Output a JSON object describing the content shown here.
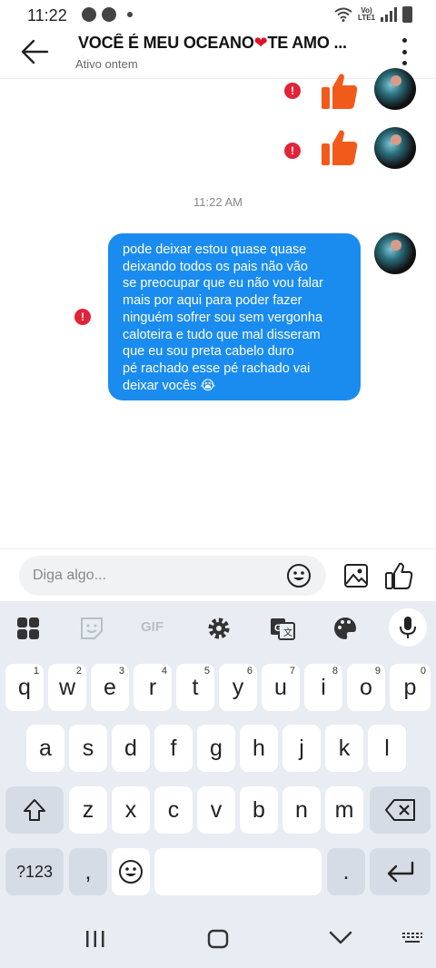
{
  "status": {
    "time": "11:22",
    "network": "Vo)\nLTE1"
  },
  "header": {
    "title_part1": "VOCÊ É MEU OCEANO",
    "title_heart": "❤",
    "title_part2": "TE AMO ...",
    "subtitle": "Ativo ontem"
  },
  "messages": {
    "error_mark": "!",
    "timestamp": "11:22 AM",
    "bubble_lines": [
      "pode deixar estou quase quase",
      "deixando todos os pais não vão",
      "se preocupar que eu não vou falar",
      "mais por aqui para poder fazer",
      "ninguém sofrer sou sem vergonha",
      "caloteira e tudo que mal disseram",
      "que eu sou preta cabelo duro",
      "pé rachado esse pé rachado vai",
      "deixar vocês 😭"
    ]
  },
  "composer": {
    "placeholder": "Diga algo..."
  },
  "keyboard": {
    "gif_label": "GIF",
    "row1": [
      {
        "k": "q",
        "n": "1"
      },
      {
        "k": "w",
        "n": "2"
      },
      {
        "k": "e",
        "n": "3"
      },
      {
        "k": "r",
        "n": "4"
      },
      {
        "k": "t",
        "n": "5"
      },
      {
        "k": "y",
        "n": "6"
      },
      {
        "k": "u",
        "n": "7"
      },
      {
        "k": "i",
        "n": "8"
      },
      {
        "k": "o",
        "n": "9"
      },
      {
        "k": "p",
        "n": "0"
      }
    ],
    "row2": [
      "a",
      "s",
      "d",
      "f",
      "g",
      "h",
      "j",
      "k",
      "l"
    ],
    "row3": [
      "z",
      "x",
      "c",
      "v",
      "b",
      "n",
      "m"
    ],
    "symbols_label": "?123",
    "comma_label": ",",
    "period_label": "."
  },
  "colors": {
    "bubble": "#1a8cf0",
    "error": "#e0243a",
    "thumb": "#f25a1c",
    "keyboard_bg": "#e8ecf3"
  }
}
